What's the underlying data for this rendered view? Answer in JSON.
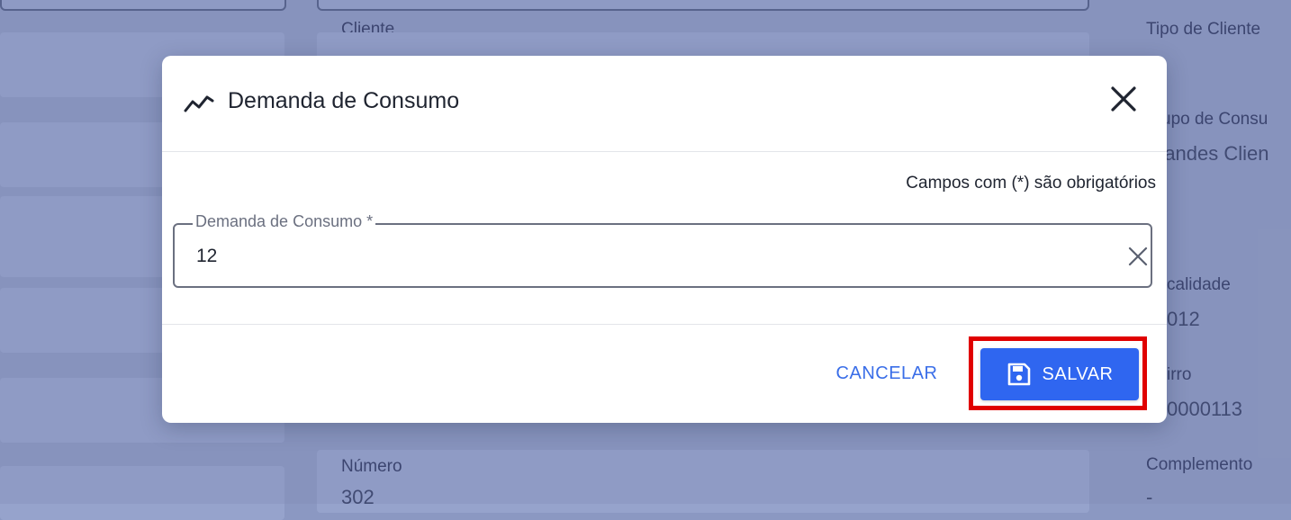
{
  "background": {
    "labels": {
      "cliente": "Cliente",
      "tipo_cliente": "Tipo de Cliente",
      "grupo_consumo": "upo de Consu",
      "grupo_consumo_value": "randes Clien",
      "localidade": "calidade",
      "localidade_value": "012",
      "bairro": "irro",
      "bairro_value": "0000113",
      "numero": "Número",
      "numero_value": "302",
      "complemento": "Complemento",
      "complemento_value": "-"
    }
  },
  "modal": {
    "title": "Demanda de Consumo",
    "title_icon": "trending-line-icon",
    "close_icon": "close-icon",
    "required_note": "Campos com (*) são obrigatórios",
    "field": {
      "label": "Demanda de Consumo *",
      "value": "12",
      "clear_icon": "clear-icon"
    },
    "buttons": {
      "cancel": "CANCELAR",
      "save": "SALVAR",
      "save_icon": "floppy-disk-icon"
    }
  },
  "colors": {
    "primary": "#2f66f0",
    "highlight": "#e00000",
    "backdrop": "#8e9bc4"
  }
}
